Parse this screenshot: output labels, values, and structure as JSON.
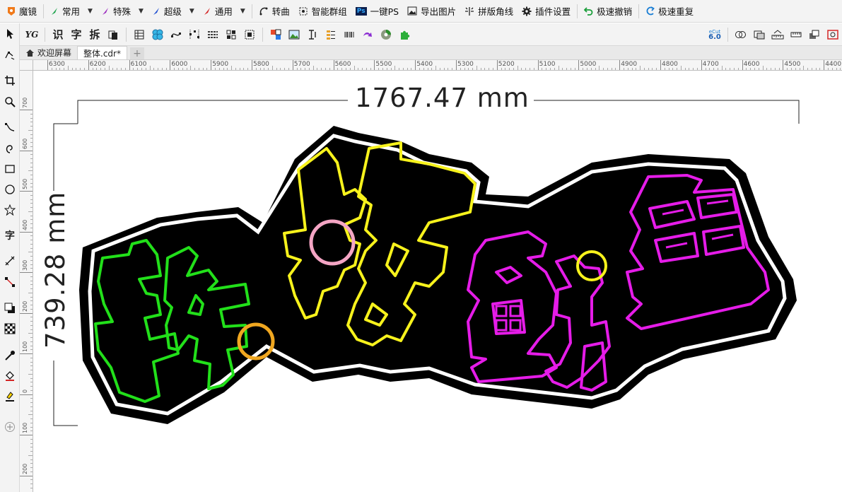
{
  "menubar": {
    "app_label": "魔镜",
    "items": [
      {
        "label": "常用",
        "color": "#1aa34a",
        "has_dropdown": true
      },
      {
        "label": "特殊",
        "color": "#9b2bbf",
        "has_dropdown": true
      },
      {
        "label": "超级",
        "color": "#1f4fd1",
        "has_dropdown": true
      },
      {
        "label": "通用",
        "color": "#d42626",
        "has_dropdown": true
      }
    ],
    "convert_label": "转曲",
    "smart_group_label": "智能群组",
    "ps_label": "一键PS",
    "export_label": "导出图片",
    "imposition_label": "拼版角线",
    "plugin_settings_label": "插件设置",
    "undo_label": "极速撤销",
    "redo_label": "极速重复",
    "ps_badge": "Ps"
  },
  "toolbar": {
    "yg_label": "YG",
    "recognize_label": "识",
    "char_label": "字",
    "split_label": "拆",
    "ecut_top": "eCut",
    "ecut_bottom": "6.0"
  },
  "tabs": {
    "welcome_label": "欢迎屏幕",
    "doc_label": "整体.cdr*",
    "add_label": "+"
  },
  "rulers": {
    "horizontal": [
      "6300",
      "6200",
      "6100",
      "6000",
      "5900",
      "5800",
      "5700",
      "5600",
      "5500",
      "5400",
      "5300",
      "5200",
      "5100",
      "5000",
      "4900",
      "4800",
      "4700",
      "4600",
      "4500",
      "4400"
    ],
    "vertical": [
      "700",
      "600",
      "500",
      "400",
      "300",
      "200",
      "100",
      "0",
      "100",
      "200"
    ]
  },
  "canvas": {
    "width_dimension": "1767.47 mm",
    "height_dimension": "739.28 mm",
    "artwork_chars": [
      "铁",
      "板",
      "鱿",
      "鱼"
    ],
    "colors": {
      "green": "#22e01a",
      "yellow": "#f7f21c",
      "magenta": "#e51ce8",
      "pink_circle": "#f4a5c4",
      "orange_circle": "#f0a720",
      "outline": "#000000"
    }
  },
  "toolbox": {
    "text_tool_label": "字"
  }
}
